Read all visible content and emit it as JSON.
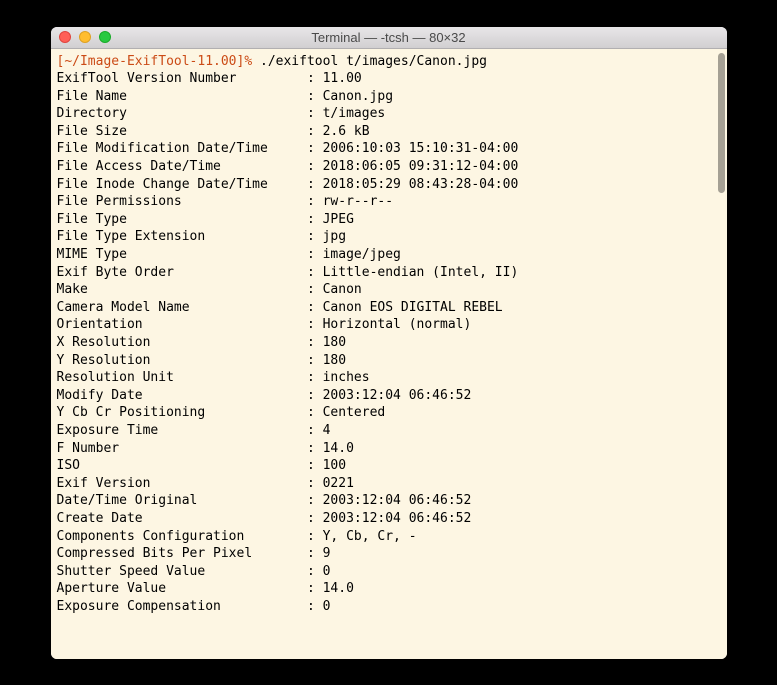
{
  "window": {
    "title": "Terminal — -tcsh — 80×32"
  },
  "prompt": {
    "path": "[~/Image-ExifTool-11.00]%",
    "command": " ./exiftool t/images/Canon.jpg"
  },
  "rows": [
    {
      "key": "ExifTool Version Number",
      "val": "11.00"
    },
    {
      "key": "File Name",
      "val": "Canon.jpg"
    },
    {
      "key": "Directory",
      "val": "t/images"
    },
    {
      "key": "File Size",
      "val": "2.6 kB"
    },
    {
      "key": "File Modification Date/Time",
      "val": "2006:10:03 15:10:31-04:00"
    },
    {
      "key": "File Access Date/Time",
      "val": "2018:06:05 09:31:12-04:00"
    },
    {
      "key": "File Inode Change Date/Time",
      "val": "2018:05:29 08:43:28-04:00"
    },
    {
      "key": "File Permissions",
      "val": "rw-r--r--"
    },
    {
      "key": "File Type",
      "val": "JPEG"
    },
    {
      "key": "File Type Extension",
      "val": "jpg"
    },
    {
      "key": "MIME Type",
      "val": "image/jpeg"
    },
    {
      "key": "Exif Byte Order",
      "val": "Little-endian (Intel, II)"
    },
    {
      "key": "Make",
      "val": "Canon"
    },
    {
      "key": "Camera Model Name",
      "val": "Canon EOS DIGITAL REBEL"
    },
    {
      "key": "Orientation",
      "val": "Horizontal (normal)"
    },
    {
      "key": "X Resolution",
      "val": "180"
    },
    {
      "key": "Y Resolution",
      "val": "180"
    },
    {
      "key": "Resolution Unit",
      "val": "inches"
    },
    {
      "key": "Modify Date",
      "val": "2003:12:04 06:46:52"
    },
    {
      "key": "Y Cb Cr Positioning",
      "val": "Centered"
    },
    {
      "key": "Exposure Time",
      "val": "4"
    },
    {
      "key": "F Number",
      "val": "14.0"
    },
    {
      "key": "ISO",
      "val": "100"
    },
    {
      "key": "Exif Version",
      "val": "0221"
    },
    {
      "key": "Date/Time Original",
      "val": "2003:12:04 06:46:52"
    },
    {
      "key": "Create Date",
      "val": "2003:12:04 06:46:52"
    },
    {
      "key": "Components Configuration",
      "val": "Y, Cb, Cr, -"
    },
    {
      "key": "Compressed Bits Per Pixel",
      "val": "9"
    },
    {
      "key": "Shutter Speed Value",
      "val": "0"
    },
    {
      "key": "Aperture Value",
      "val": "14.0"
    },
    {
      "key": "Exposure Compensation",
      "val": "0"
    }
  ]
}
